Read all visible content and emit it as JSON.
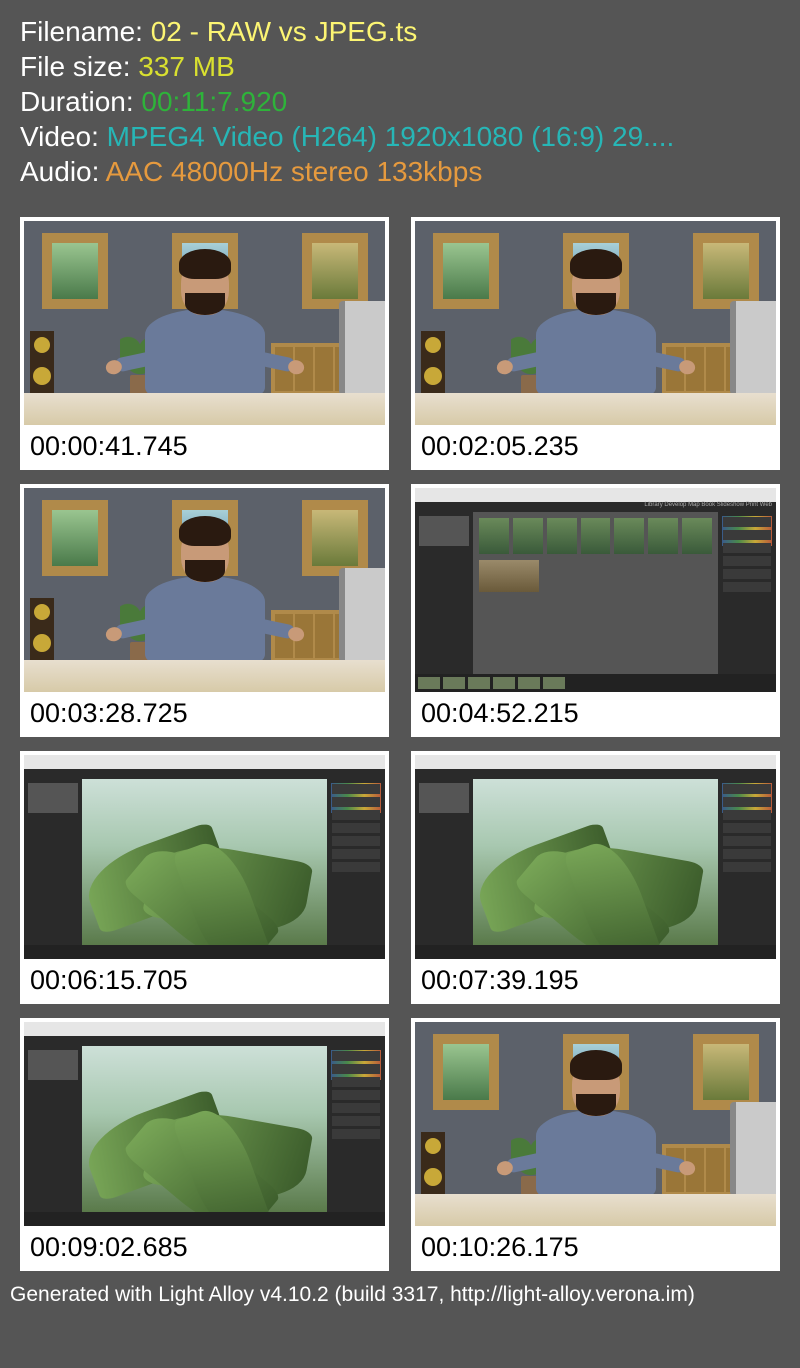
{
  "info": {
    "filename_label": "Filename: ",
    "filename_value": "02 - RAW vs JPEG.ts",
    "filesize_label": "File size: ",
    "filesize_value": "337 MB",
    "duration_label": "Duration: ",
    "duration_value": "00:11:7.920",
    "video_label": "Video: ",
    "video_value": "MPEG4 Video (H264) 1920x1080 (16:9) 29....",
    "audio_label": "Audio: ",
    "audio_value": "AAC 48000Hz stereo 133kbps"
  },
  "thumbnails": [
    {
      "timestamp": "00:00:41.745",
      "kind": "studio"
    },
    {
      "timestamp": "00:02:05.235",
      "kind": "studio"
    },
    {
      "timestamp": "00:03:28.725",
      "kind": "studio"
    },
    {
      "timestamp": "00:04:52.215",
      "kind": "lr-grid"
    },
    {
      "timestamp": "00:06:15.705",
      "kind": "lr-photo"
    },
    {
      "timestamp": "00:07:39.195",
      "kind": "lr-photo"
    },
    {
      "timestamp": "00:09:02.685",
      "kind": "lr-photo"
    },
    {
      "timestamp": "00:10:26.175",
      "kind": "studio"
    }
  ],
  "footer": "Generated with Light Alloy v4.10.2 (build 3317, http://light-alloy.verona.im)"
}
